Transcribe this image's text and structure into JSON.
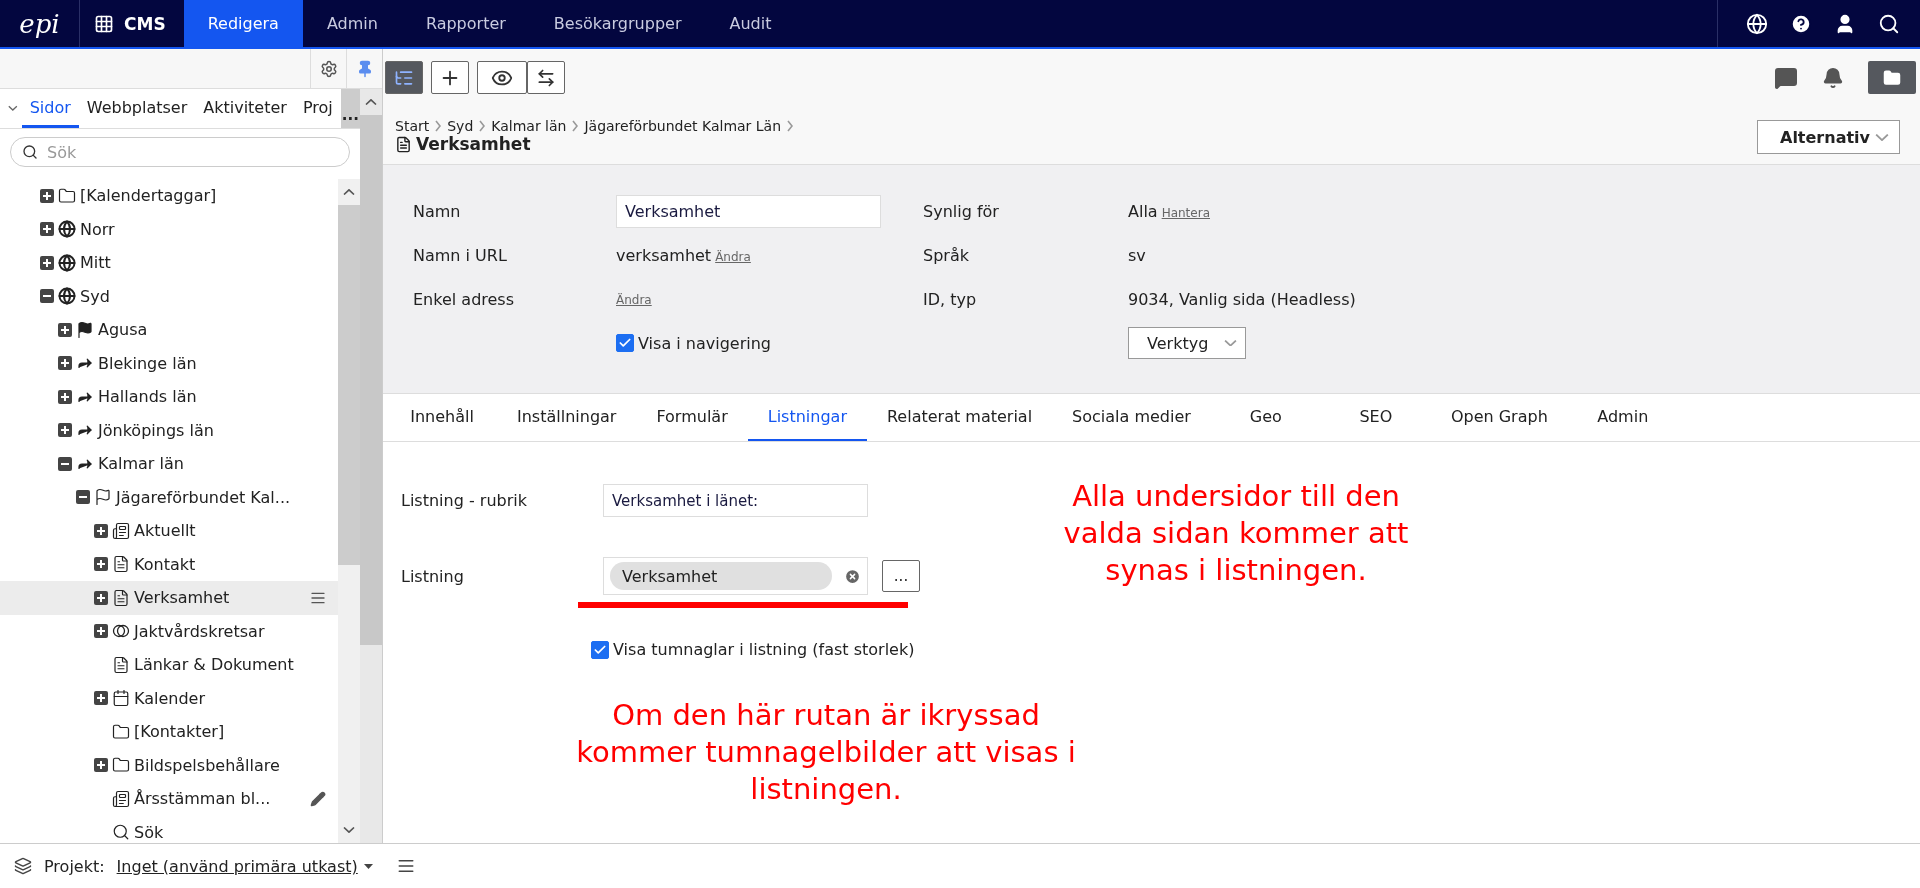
{
  "topbar": {
    "logo": "epi",
    "app": "CMS",
    "nav": [
      {
        "label": "Redigera",
        "selected": true
      },
      {
        "label": "Admin",
        "selected": false
      },
      {
        "label": "Rapporter",
        "selected": false
      },
      {
        "label": "Besökargrupper",
        "selected": false
      },
      {
        "label": "Audit",
        "selected": false
      }
    ]
  },
  "sidebar": {
    "tabs": [
      {
        "label": "Sidor",
        "selected": true
      },
      {
        "label": "Webbplatser",
        "selected": false
      },
      {
        "label": "Aktiviteter",
        "selected": false
      },
      {
        "label": "Proj",
        "selected": false
      }
    ],
    "more": "...",
    "search": {
      "placeholder": "Sök"
    },
    "tree": [
      {
        "label": "[Kalendertaggar]",
        "kind": "folder",
        "has_children": true,
        "expanded": false,
        "selected": false
      },
      {
        "label": "Norr",
        "kind": "globe",
        "has_children": true,
        "expanded": false,
        "selected": false
      },
      {
        "label": "Mitt",
        "kind": "globe",
        "has_children": true,
        "expanded": false,
        "selected": false
      },
      {
        "label": "Syd",
        "kind": "globe",
        "has_children": true,
        "expanded": true,
        "selected": false,
        "children": [
          {
            "label": "Agusa",
            "kind": "flag",
            "has_children": true,
            "expanded": false,
            "selected": false
          },
          {
            "label": "Blekinge län",
            "kind": "redirect",
            "has_children": true,
            "expanded": false,
            "selected": false
          },
          {
            "label": "Hallands län",
            "kind": "redirect",
            "has_children": true,
            "expanded": false,
            "selected": false
          },
          {
            "label": "Jönköpings län",
            "kind": "redirect",
            "has_children": true,
            "expanded": false,
            "selected": false
          },
          {
            "label": "Kalmar län",
            "kind": "redirect",
            "has_children": true,
            "expanded": true,
            "selected": false,
            "children": [
              {
                "label": "Jägareförbundet Kal...",
                "kind": "flag-outline",
                "has_children": true,
                "expanded": true,
                "selected": false,
                "children": [
                  {
                    "label": "Aktuellt",
                    "kind": "news",
                    "has_children": true,
                    "expanded": false,
                    "selected": false,
                    "editing": false
                  },
                  {
                    "label": "Kontakt",
                    "kind": "page",
                    "has_children": true,
                    "expanded": false,
                    "selected": false,
                    "editing": false
                  },
                  {
                    "label": "Verksamhet",
                    "kind": "page",
                    "has_children": true,
                    "expanded": false,
                    "selected": true,
                    "editing": false
                  },
                  {
                    "label": "Jaktvårdskretsar",
                    "kind": "circles",
                    "has_children": true,
                    "expanded": false,
                    "selected": false,
                    "editing": false
                  },
                  {
                    "label": "Länkar & Dokument",
                    "kind": "page",
                    "has_children": false,
                    "selected": false,
                    "editing": false
                  },
                  {
                    "label": "Kalender",
                    "kind": "calendar",
                    "has_children": true,
                    "expanded": false,
                    "selected": false,
                    "editing": false
                  },
                  {
                    "label": "[Kontakter]",
                    "kind": "folder",
                    "has_children": false,
                    "selected": false,
                    "editing": false
                  },
                  {
                    "label": "Bildspelsbehållare",
                    "kind": "folder",
                    "has_children": true,
                    "expanded": false,
                    "selected": false,
                    "editing": false
                  },
                  {
                    "label": "Årsstämman bl...",
                    "kind": "news",
                    "has_children": false,
                    "selected": false,
                    "editing": true
                  },
                  {
                    "label": "Sök",
                    "kind": "search",
                    "has_children": false,
                    "selected": false,
                    "editing": false
                  }
                ]
              }
            ]
          }
        ]
      }
    ]
  },
  "status_bar": {
    "label": "Projekt:",
    "project": "Inget (använd primära utkast)"
  },
  "page": {
    "breadcrumb": [
      "Start",
      "Syd",
      "Kalmar län",
      "Jägareförbundet Kalmar Län"
    ],
    "title": "Verksamhet",
    "options_button": "Alternativ",
    "properties": {
      "name_label": "Namn",
      "name_value": "Verksamhet",
      "url_label": "Namn i URL",
      "url_value": "verksamhet",
      "url_link": "Ändra",
      "address_label": "Enkel adress",
      "address_link": "Ändra",
      "nav_checkbox": {
        "label": "Visa i navigering",
        "checked": true
      },
      "visible_label": "Synlig för",
      "visible_value": "Alla",
      "visible_link": "Hantera",
      "lang_label": "Språk",
      "lang_value": "sv",
      "id_label": "ID, typ",
      "id_value": "9034, Vanlig sida (Headless)",
      "tools_button": "Verktyg"
    },
    "tabs": [
      {
        "label": "Innehåll",
        "selected": false
      },
      {
        "label": "Inställningar",
        "selected": false
      },
      {
        "label": "Formulär",
        "selected": false
      },
      {
        "label": "Listningar",
        "selected": true
      },
      {
        "label": "Relaterat material",
        "selected": false
      },
      {
        "label": "Sociala medier",
        "selected": false
      },
      {
        "label": "Geo",
        "selected": false
      },
      {
        "label": "SEO",
        "selected": false
      },
      {
        "label": "Open Graph",
        "selected": false
      },
      {
        "label": "Admin",
        "selected": false
      }
    ],
    "listing": {
      "heading_label": "Listning - rubrik",
      "heading_value": "Verksamhet i länet:",
      "listing_label": "Listning",
      "listing_value": "Verksamhet",
      "browse_button": "...",
      "thumbs_checkbox": {
        "label": "Visa tumnaglar i listning (fast storlek)",
        "checked": true
      }
    },
    "annotations": [
      "Alla undersidor till den valda sidan kommer att synas i listningen.",
      "Om den här rutan är ikryssad kommer tumnagelbilder att visas i listningen."
    ]
  }
}
